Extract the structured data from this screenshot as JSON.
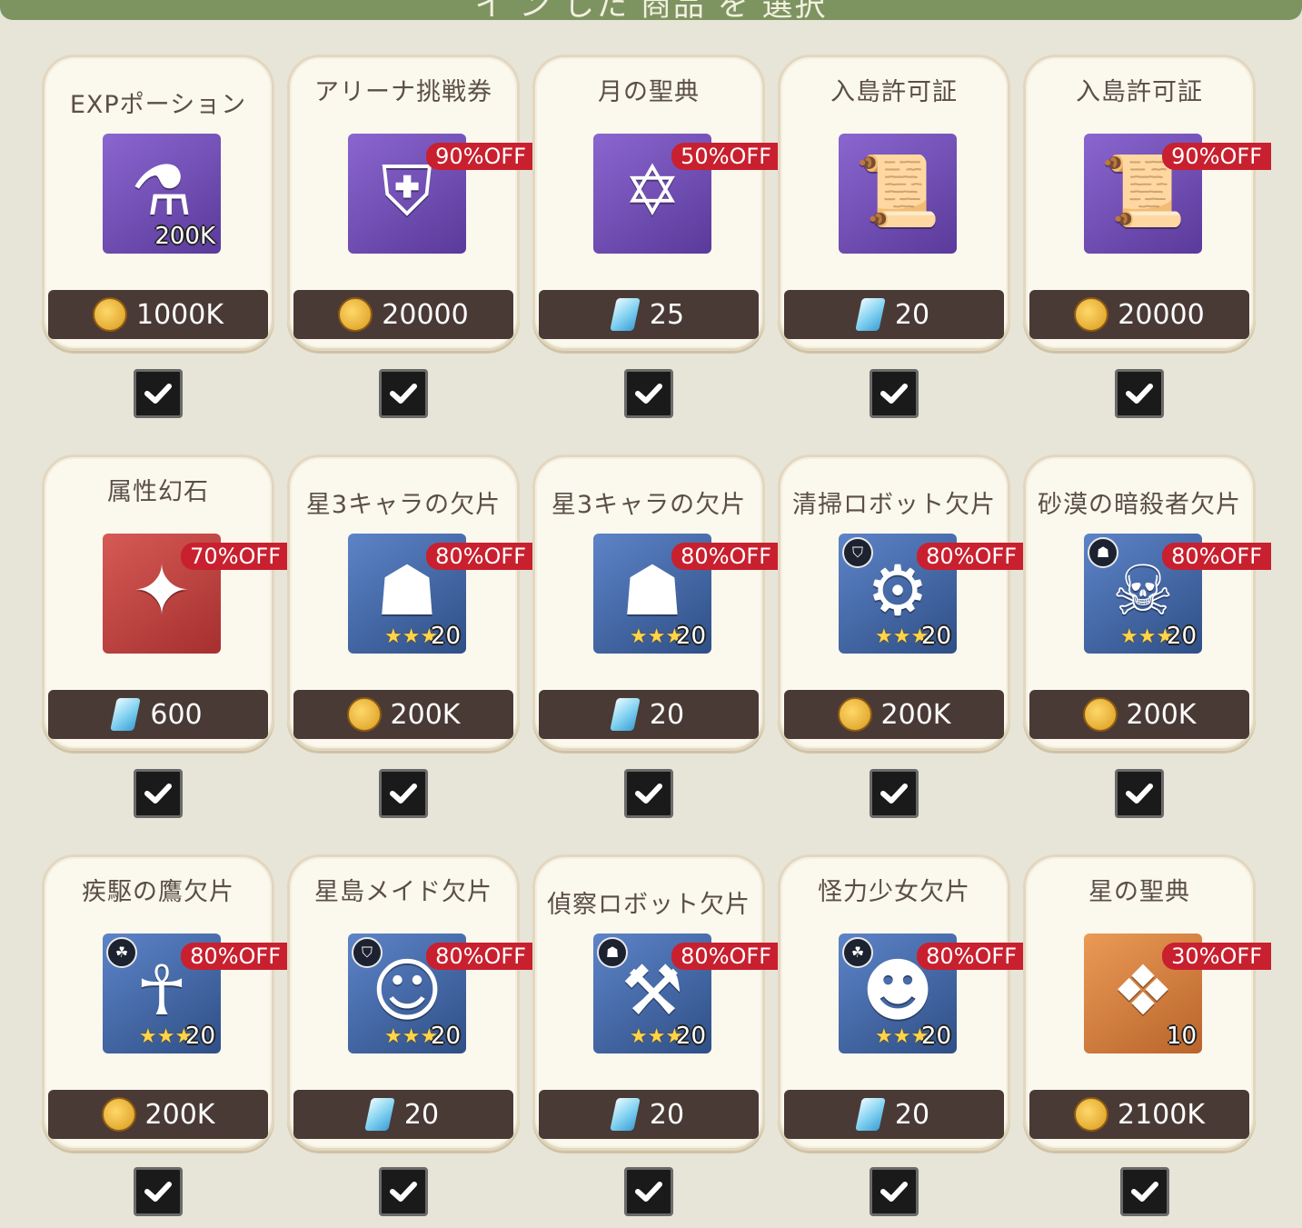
{
  "header": {
    "title": "イ ン した 商品 を 選択"
  },
  "items": [
    {
      "name": "EXPポーション",
      "price": "1000K",
      "currency": "coin",
      "discount": "",
      "icon": "potion-icon",
      "glyph": "⚗",
      "bg": "purple",
      "qty": "200K",
      "stars": ""
    },
    {
      "name": "アリーナ挑戦券",
      "price": "20000",
      "currency": "coin",
      "discount": "90%OFF",
      "icon": "helmet-ticket-icon",
      "glyph": "⛨",
      "bg": "purple",
      "qty": "",
      "stars": ""
    },
    {
      "name": "月の聖典",
      "price": "25",
      "currency": "gem",
      "discount": "50%OFF",
      "icon": "moon-tome-icon",
      "glyph": "✡",
      "bg": "purple",
      "qty": "",
      "stars": ""
    },
    {
      "name": "入島許可証",
      "price": "20",
      "currency": "gem",
      "discount": "",
      "icon": "island-permit-icon",
      "glyph": "📜",
      "bg": "purple",
      "qty": "",
      "stars": ""
    },
    {
      "name": "入島許可証",
      "price": "20000",
      "currency": "coin",
      "discount": "90%OFF",
      "icon": "island-permit-icon",
      "glyph": "📜",
      "bg": "purple",
      "qty": "",
      "stars": ""
    },
    {
      "name": "属性幻石",
      "price": "600",
      "currency": "gem",
      "discount": "70%OFF",
      "icon": "attribute-stone-icon",
      "glyph": "✦",
      "bg": "red",
      "qty": "",
      "stars": ""
    },
    {
      "name": "星3キャラの欠片",
      "price": "200K",
      "currency": "coin",
      "discount": "80%OFF",
      "icon": "knight-helmet-icon",
      "glyph": "☗",
      "bg": "blue",
      "qty": "20",
      "stars": "★★★"
    },
    {
      "name": "星3キャラの欠片",
      "price": "20",
      "currency": "gem",
      "discount": "80%OFF",
      "icon": "knight-helmet-icon",
      "glyph": "☗",
      "bg": "blue",
      "qty": "20",
      "stars": "★★★"
    },
    {
      "name": "清掃ロボット欠片",
      "price": "200K",
      "currency": "coin",
      "discount": "80%OFF",
      "icon": "cleaning-robot-icon",
      "glyph": "⚙",
      "bg": "blue",
      "qty": "20",
      "stars": "★★★",
      "attr": "⛉"
    },
    {
      "name": "砂漠の暗殺者欠片",
      "price": "200K",
      "currency": "coin",
      "discount": "80%OFF",
      "icon": "desert-assassin-icon",
      "glyph": "☠",
      "bg": "blue",
      "qty": "20",
      "stars": "★★★",
      "attr": "☗"
    },
    {
      "name": "疾駆の鷹欠片",
      "price": "200K",
      "currency": "coin",
      "discount": "80%OFF",
      "icon": "swift-hawk-icon",
      "glyph": "☥",
      "bg": "blue",
      "qty": "20",
      "stars": "★★★",
      "attr": "☘"
    },
    {
      "name": "星島メイド欠片",
      "price": "20",
      "currency": "gem",
      "discount": "80%OFF",
      "icon": "star-island-maid-icon",
      "glyph": "☺",
      "bg": "blue",
      "qty": "20",
      "stars": "★★★",
      "attr": "⛉"
    },
    {
      "name": "偵察ロボット欠片",
      "price": "20",
      "currency": "gem",
      "discount": "80%OFF",
      "icon": "scout-robot-icon",
      "glyph": "⚒",
      "bg": "blue",
      "qty": "20",
      "stars": "★★★",
      "attr": "☗"
    },
    {
      "name": "怪力少女欠片",
      "price": "20",
      "currency": "gem",
      "discount": "80%OFF",
      "icon": "strong-girl-icon",
      "glyph": "☻",
      "bg": "blue",
      "qty": "20",
      "stars": "★★★",
      "attr": "☘"
    },
    {
      "name": "星の聖典",
      "price": "2100K",
      "currency": "coin",
      "discount": "30%OFF",
      "icon": "star-tome-icon",
      "glyph": "❖",
      "bg": "orange",
      "qty": "10",
      "stars": ""
    }
  ],
  "colors": {
    "accent_red": "#c8202f",
    "price_bar": "#4a3a35",
    "background": "#e7e4d8"
  }
}
